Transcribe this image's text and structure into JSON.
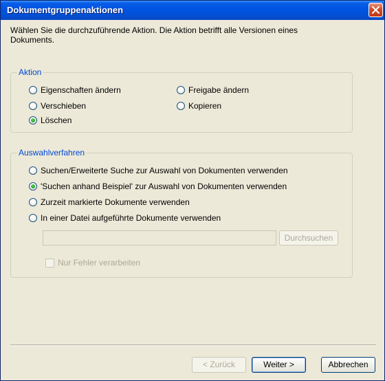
{
  "window": {
    "title": "Dokumentgruppenaktionen"
  },
  "description": "Wählen Sie die durchzuführende Aktion. Die Aktion betrifft alle Versionen eines Dokuments.",
  "action_group": {
    "label": "Aktion",
    "options": [
      {
        "label": "Eigenschaften ändern",
        "selected": false
      },
      {
        "label": "Freigabe ändern",
        "selected": false
      },
      {
        "label": "Verschieben",
        "selected": false
      },
      {
        "label": "Kopieren",
        "selected": false
      },
      {
        "label": "Löschen",
        "selected": true
      }
    ]
  },
  "selection_group": {
    "label": "Auswahlverfahren",
    "options": [
      {
        "label": "Suchen/Erweiterte Suche zur Auswahl von Dokumenten verwenden",
        "selected": false
      },
      {
        "label": "'Suchen anhand Beispiel' zur Auswahl von Dokumenten verwenden",
        "selected": true
      },
      {
        "label": "Zurzeit markierte Dokumente verwenden",
        "selected": false
      },
      {
        "label": "In einer Datei aufgeführte Dokumente verwenden",
        "selected": false
      }
    ],
    "file_path_value": "",
    "browse_label": "Durchsuchen",
    "errors_only_label": "Nur Fehler verarbeiten"
  },
  "buttons": {
    "back": "< Zurück",
    "next": "Weiter >",
    "cancel": "Abbrechen"
  },
  "colors": {
    "titlebar": "#0054e3",
    "group_label": "#0046d5",
    "radio_selected": "#21a121",
    "close_button": "#d44a23"
  }
}
